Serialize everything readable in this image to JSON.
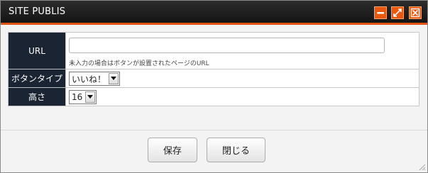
{
  "window": {
    "title": "SITE PUBLIS",
    "controls": [
      "minimize-icon",
      "maximize-icon",
      "close-icon"
    ],
    "accent_color": "#e0520f"
  },
  "form": {
    "url": {
      "label": "URL",
      "value": "",
      "hint": "未入力の場合はボタンが設置されたページのURL"
    },
    "button_type": {
      "label": "ボタンタイプ",
      "selected": "いいね！"
    },
    "height": {
      "label": "高さ",
      "selected": "16"
    }
  },
  "footer": {
    "save_label": "保存",
    "close_label": "閉じる"
  }
}
